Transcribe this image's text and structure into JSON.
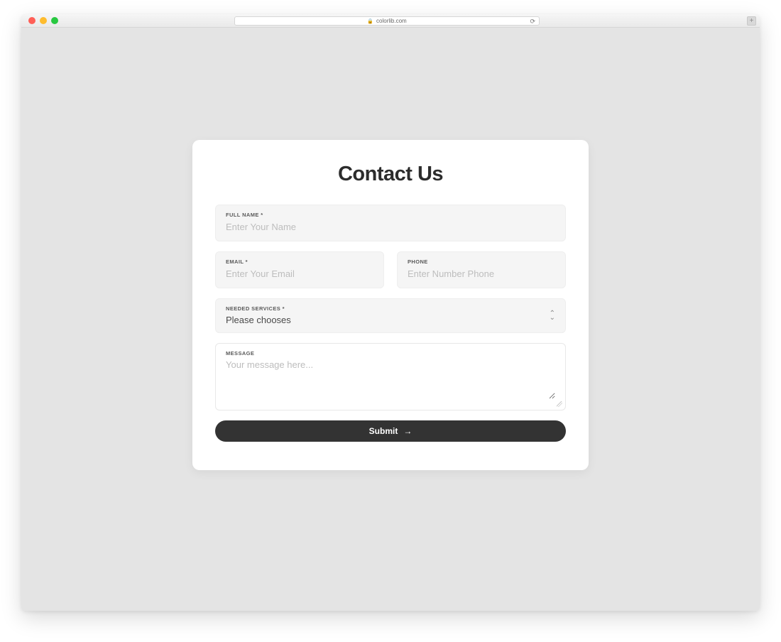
{
  "browser": {
    "url": "colorlib.com"
  },
  "form": {
    "title": "Contact Us",
    "full_name": {
      "label": "FULL NAME *",
      "placeholder": "Enter Your Name"
    },
    "email": {
      "label": "EMAIL *",
      "placeholder": "Enter Your Email"
    },
    "phone": {
      "label": "PHONE",
      "placeholder": "Enter Number Phone"
    },
    "services": {
      "label": "NEEDED SERVICES *",
      "selected": "Please chooses"
    },
    "message": {
      "label": "MESSAGE",
      "placeholder": "Your message here..."
    },
    "submit_label": "Submit"
  }
}
